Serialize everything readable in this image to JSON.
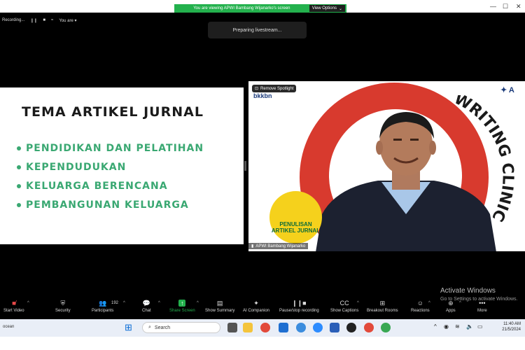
{
  "banner": {
    "text": "You are viewing APWI Bambang Wijanarko's screen",
    "view_options": "View Options"
  },
  "recording": {
    "status": "Recording...",
    "user_label": "You are"
  },
  "livestream": {
    "status": "Preparing livestream..."
  },
  "slide": {
    "title": "TEMA ARTIKEL JURNAL",
    "bullets": [
      "PENDIDIKAN DAN PELATIHAN",
      "KEPENDUDUKAN",
      "KELUARGA BERENCANA",
      "PEMBANGUNAN KELUARGA"
    ]
  },
  "speaker": {
    "spotlight_label": "Remove Spotlight",
    "org_logo": "bkkbn",
    "badge_text": "PENULISAN ARTIKEL JURNAL",
    "side_text": "WRITING CLINIC",
    "name": "APWI Bambang Wijanarko"
  },
  "activation": {
    "title": "Activate Windows",
    "subtitle": "Go to Settings to activate Windows."
  },
  "toolbar": {
    "items": [
      {
        "label": "Start Video",
        "icon": "video-off-icon"
      },
      {
        "label": "Security",
        "icon": "shield-icon"
      },
      {
        "label": "Participants",
        "icon": "participants-icon",
        "count": "192"
      },
      {
        "label": "Chat",
        "icon": "chat-icon"
      },
      {
        "label": "Share Screen",
        "icon": "share-screen-icon"
      },
      {
        "label": "Show Summary",
        "icon": "summary-icon"
      },
      {
        "label": "AI Companion",
        "icon": "sparkle-icon"
      },
      {
        "label": "Pause/stop recording",
        "icon": "pause-stop-icon"
      },
      {
        "label": "Show Captions",
        "icon": "captions-icon"
      },
      {
        "label": "Breakout Rooms",
        "icon": "breakout-icon"
      },
      {
        "label": "Reactions",
        "icon": "reactions-icon"
      },
      {
        "label": "Apps",
        "icon": "apps-icon"
      },
      {
        "label": "More",
        "icon": "more-icon"
      }
    ]
  },
  "taskbar": {
    "search_placeholder": "Search",
    "left_text": "ocean",
    "time": "11:40 AM",
    "date": "21/5/2024"
  }
}
